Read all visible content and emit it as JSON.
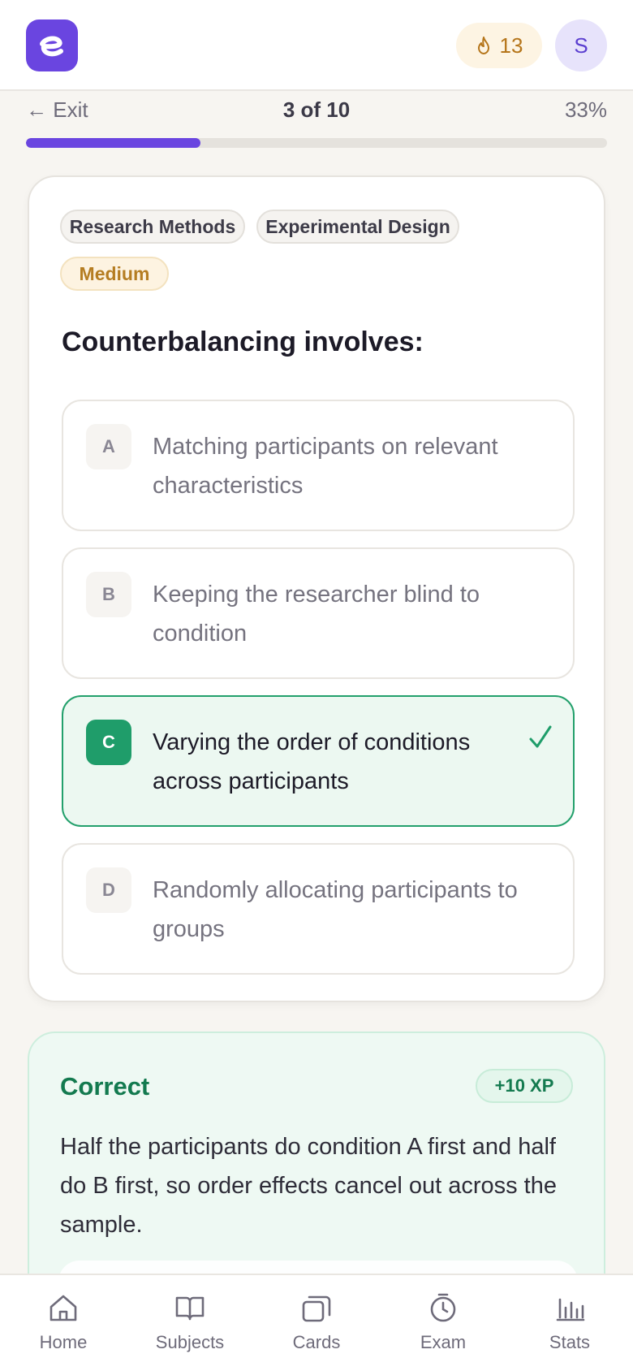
{
  "header": {
    "streak_count": "13",
    "avatar_initial": "S"
  },
  "progress": {
    "exit_label": "← Exit",
    "counter": "3 of 10",
    "percent_label": "33%",
    "fill_fraction": 0.3
  },
  "question": {
    "tags": [
      "Research Methods",
      "Experimental Design"
    ],
    "difficulty": "Medium",
    "prompt": "Counterbalancing involves:",
    "options": [
      {
        "letter": "A",
        "text": "Matching participants on relevant characteristics"
      },
      {
        "letter": "B",
        "text": "Keeping the researcher blind to condition"
      },
      {
        "letter": "C",
        "text": "Varying the order of conditions across participants",
        "state": "correct"
      },
      {
        "letter": "D",
        "text": "Randomly allocating participants to groups"
      }
    ]
  },
  "feedback": {
    "title": "Correct",
    "xp": "+10 XP",
    "explanation": "Half the participants do condition A first and half do B first, so order effects cancel out across the sample."
  },
  "nav": {
    "items": [
      {
        "label": "Home",
        "icon": "home-icon"
      },
      {
        "label": "Subjects",
        "icon": "book-icon"
      },
      {
        "label": "Cards",
        "icon": "cards-icon"
      },
      {
        "label": "Exam",
        "icon": "timer-icon"
      },
      {
        "label": "Stats",
        "icon": "bar-chart-icon"
      }
    ]
  },
  "colors": {
    "brand": "#6a45e0",
    "correct": "#1f9d6a",
    "streak": "#b5751a"
  }
}
